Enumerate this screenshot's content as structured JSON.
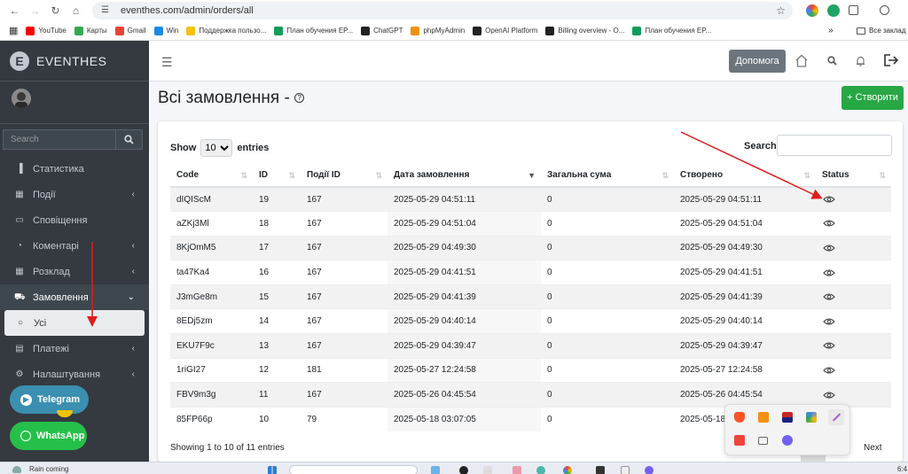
{
  "browser": {
    "url": "eventhes.com/admin/orders/all",
    "bookmarks": [
      {
        "label": "YouTube",
        "color": "#ff0000"
      },
      {
        "label": "Карты",
        "color": "#34a853"
      },
      {
        "label": "Gmail",
        "color": "#ea4335"
      },
      {
        "label": "Win",
        "color": "#1e88e5"
      },
      {
        "label": "Поддержка пользо...",
        "color": "#f4c20d"
      },
      {
        "label": "План обучения EP...",
        "color": "#0f9d58"
      },
      {
        "label": "ChatGPT",
        "color": "#222222"
      },
      {
        "label": "phpMyAdmin",
        "color": "#f29111"
      },
      {
        "label": "OpenAI Platform",
        "color": "#222222"
      },
      {
        "label": "Billing overview - O...",
        "color": "#222222"
      },
      {
        "label": "План обучения EP...",
        "color": "#0f9d58"
      }
    ],
    "all_bookmarks": "Все заклад"
  },
  "sidebar": {
    "brand_letter": "E",
    "brand": "EVENTHES",
    "search_placeholder": "Search",
    "items": [
      {
        "label": "Статистика",
        "icon": "chart-bar-icon",
        "glyph": "▐",
        "chevron": ""
      },
      {
        "label": "Події",
        "icon": "calendar-icon",
        "glyph": "▦",
        "chevron": "‹"
      },
      {
        "label": "Сповіщення",
        "icon": "message-icon",
        "glyph": "▭",
        "chevron": ""
      },
      {
        "label": "Коментарі",
        "icon": "comment-icon",
        "glyph": "◔",
        "chevron": "‹"
      },
      {
        "label": "Розклад",
        "icon": "calendar-icon",
        "glyph": "▦",
        "chevron": "‹"
      },
      {
        "label": "Замовлення",
        "icon": "cart-icon",
        "glyph": "⛟",
        "chevron": "⌄"
      },
      {
        "label": "Усі",
        "icon": "circle-icon",
        "glyph": "○",
        "chevron": ""
      },
      {
        "label": "Платежі",
        "icon": "money-icon",
        "glyph": "▤",
        "chevron": "‹"
      },
      {
        "label": "Налаштування",
        "icon": "gear-icon",
        "glyph": "⚙",
        "chevron": "‹"
      }
    ],
    "telegram": "Telegram",
    "whatsapp": "WhatsApp"
  },
  "header": {
    "help": "Допомога"
  },
  "page": {
    "title": "Всі замовлення -",
    "create": "+ Створити"
  },
  "table": {
    "show_label": "Show",
    "entries_label": "entries",
    "page_size": "10",
    "search_label": "Search:",
    "columns": [
      "Code",
      "ID",
      "Події ID",
      "Дата замовлення",
      "Загальна сума",
      "Створено",
      "Status"
    ],
    "rows": [
      [
        "dIQIScM",
        "19",
        "167",
        "2025-05-29 04:51:11",
        "0",
        "2025-05-29 04:51:11"
      ],
      [
        "aZKj3Ml",
        "18",
        "167",
        "2025-05-29 04:51:04",
        "0",
        "2025-05-29 04:51:04"
      ],
      [
        "8KjOmM5",
        "17",
        "167",
        "2025-05-29 04:49:30",
        "0",
        "2025-05-29 04:49:30"
      ],
      [
        "ta47Ka4",
        "16",
        "167",
        "2025-05-29 04:41:51",
        "0",
        "2025-05-29 04:41:51"
      ],
      [
        "J3mGe8m",
        "15",
        "167",
        "2025-05-29 04:41:39",
        "0",
        "2025-05-29 04:41:39"
      ],
      [
        "8EDj5zm",
        "14",
        "167",
        "2025-05-29 04:40:14",
        "0",
        "2025-05-29 04:40:14"
      ],
      [
        "EKU7F9c",
        "13",
        "167",
        "2025-05-29 04:39:47",
        "0",
        "2025-05-29 04:39:47"
      ],
      [
        "1riGI27",
        "12",
        "181",
        "2025-05-27 12:24:58",
        "0",
        "2025-05-27 12:24:58"
      ],
      [
        "FBV9m3g",
        "11",
        "167",
        "2025-05-26 04:45:54",
        "0",
        "2025-05-26 04:45:54"
      ],
      [
        "85FP66p",
        "10",
        "79",
        "2025-05-18 03:07:05",
        "0",
        "2025-05-18"
      ]
    ],
    "info": "Showing 1 to 10 of 11 entries",
    "next": "Next"
  },
  "taskbar": {
    "weather": "Rain coming",
    "clock": "6:4"
  },
  "colors": {
    "sidebar_bg": "#343a40",
    "create_button": "#28a745",
    "help_button": "#6c757d",
    "telegram": "#3b8fb0",
    "whatsapp": "#25c04a",
    "annotation_arrow": "#e01b1b"
  }
}
